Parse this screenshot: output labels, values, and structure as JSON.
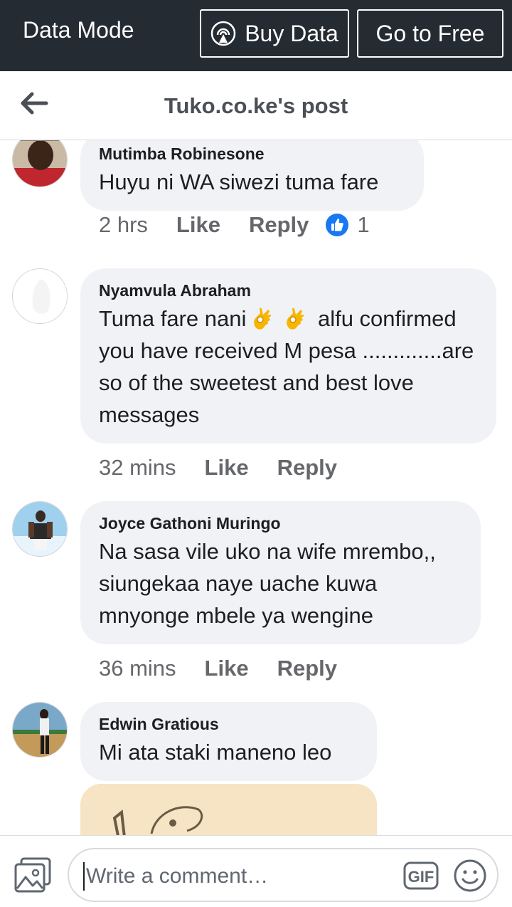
{
  "banner": {
    "title": "Data Mode",
    "buy_data_label": "Buy Data",
    "go_free_label": "Go to Free"
  },
  "header": {
    "title": "Tuko.co.ke's post"
  },
  "comments": [
    {
      "name": "Mutimba Robinesone",
      "text": "Huyu ni WA siwezi tuma fare",
      "time": "2 hrs",
      "like_label": "Like",
      "reply_label": "Reply",
      "reactions": "1"
    },
    {
      "name": "Nyamvula Abraham",
      "text_part1": "Tuma fare nani",
      "text_part2": " alfu confirmed you have received M pesa .............are so of the sweetest and best love messages",
      "time": "32 mins",
      "like_label": "Like",
      "reply_label": "Reply"
    },
    {
      "name": "Joyce Gathoni Muringo",
      "text": "Na sasa vile uko na wife mrembo,, siungekaa naye uache kuwa mnyonge mbele ya wengine",
      "time": "36 mins",
      "like_label": "Like",
      "reply_label": "Reply"
    },
    {
      "name": "Edwin Gratious",
      "text": "Mi ata staki maneno leo"
    }
  ],
  "composer": {
    "placeholder": "Write a comment…"
  },
  "colors": {
    "banner_bg": "#252b33",
    "bubble_bg": "#f0f2f5",
    "like_blue": "#1877f2",
    "muted_text": "#65676b"
  },
  "icons": {
    "back": "back-arrow-icon",
    "buy_data": "broadcast-icon",
    "like_reaction": "thumbs-up-icon",
    "emoji": "ok-hand-emoji",
    "photo": "photo-icon",
    "gif": "gif-icon",
    "sticker": "smiley-icon"
  }
}
